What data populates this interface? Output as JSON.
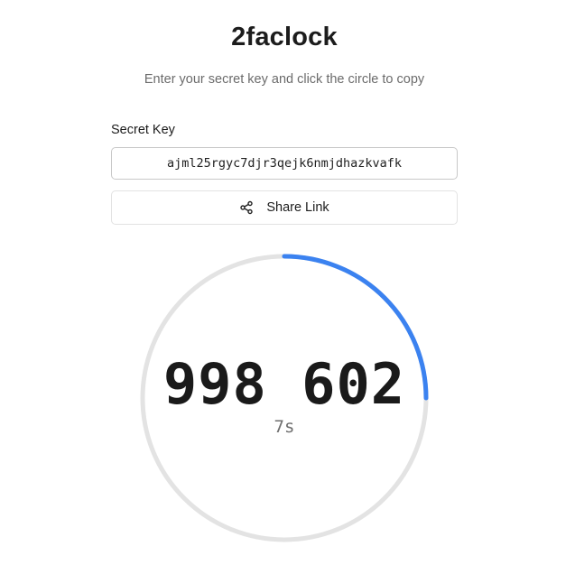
{
  "app": {
    "title": "2faclock",
    "subtitle": "Enter your secret key and click the circle to copy"
  },
  "secret": {
    "label": "Secret Key",
    "value": "ajml25rgyc7djr3qejk6nmjdhazkvafk"
  },
  "share": {
    "label": "Share Link",
    "icon": "share-icon"
  },
  "timer": {
    "code": "998 602",
    "seconds_label": "7s",
    "progress_fraction": 0.25,
    "colors": {
      "track": "#e3e3e3",
      "progress": "#3b82f0"
    }
  }
}
